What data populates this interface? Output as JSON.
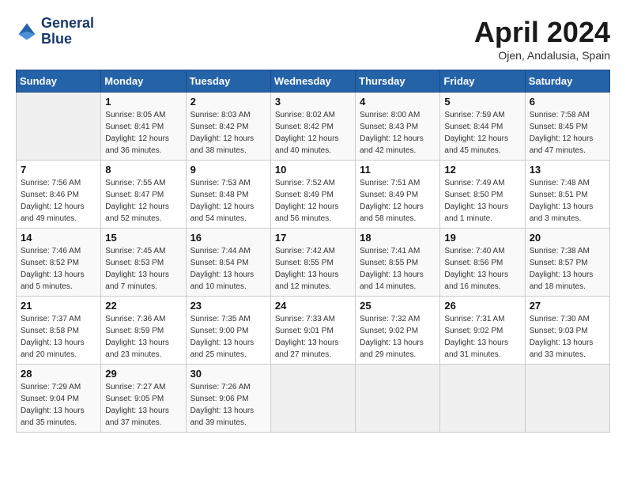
{
  "header": {
    "logo_line1": "General",
    "logo_line2": "Blue",
    "month_title": "April 2024",
    "location": "Ojen, Andalusia, Spain"
  },
  "calendar": {
    "days_of_week": [
      "Sunday",
      "Monday",
      "Tuesday",
      "Wednesday",
      "Thursday",
      "Friday",
      "Saturday"
    ],
    "weeks": [
      [
        {
          "day": "",
          "info": ""
        },
        {
          "day": "1",
          "info": "Sunrise: 8:05 AM\nSunset: 8:41 PM\nDaylight: 12 hours\nand 36 minutes."
        },
        {
          "day": "2",
          "info": "Sunrise: 8:03 AM\nSunset: 8:42 PM\nDaylight: 12 hours\nand 38 minutes."
        },
        {
          "day": "3",
          "info": "Sunrise: 8:02 AM\nSunset: 8:42 PM\nDaylight: 12 hours\nand 40 minutes."
        },
        {
          "day": "4",
          "info": "Sunrise: 8:00 AM\nSunset: 8:43 PM\nDaylight: 12 hours\nand 42 minutes."
        },
        {
          "day": "5",
          "info": "Sunrise: 7:59 AM\nSunset: 8:44 PM\nDaylight: 12 hours\nand 45 minutes."
        },
        {
          "day": "6",
          "info": "Sunrise: 7:58 AM\nSunset: 8:45 PM\nDaylight: 12 hours\nand 47 minutes."
        }
      ],
      [
        {
          "day": "7",
          "info": "Sunrise: 7:56 AM\nSunset: 8:46 PM\nDaylight: 12 hours\nand 49 minutes."
        },
        {
          "day": "8",
          "info": "Sunrise: 7:55 AM\nSunset: 8:47 PM\nDaylight: 12 hours\nand 52 minutes."
        },
        {
          "day": "9",
          "info": "Sunrise: 7:53 AM\nSunset: 8:48 PM\nDaylight: 12 hours\nand 54 minutes."
        },
        {
          "day": "10",
          "info": "Sunrise: 7:52 AM\nSunset: 8:49 PM\nDaylight: 12 hours\nand 56 minutes."
        },
        {
          "day": "11",
          "info": "Sunrise: 7:51 AM\nSunset: 8:49 PM\nDaylight: 12 hours\nand 58 minutes."
        },
        {
          "day": "12",
          "info": "Sunrise: 7:49 AM\nSunset: 8:50 PM\nDaylight: 13 hours\nand 1 minute."
        },
        {
          "day": "13",
          "info": "Sunrise: 7:48 AM\nSunset: 8:51 PM\nDaylight: 13 hours\nand 3 minutes."
        }
      ],
      [
        {
          "day": "14",
          "info": "Sunrise: 7:46 AM\nSunset: 8:52 PM\nDaylight: 13 hours\nand 5 minutes."
        },
        {
          "day": "15",
          "info": "Sunrise: 7:45 AM\nSunset: 8:53 PM\nDaylight: 13 hours\nand 7 minutes."
        },
        {
          "day": "16",
          "info": "Sunrise: 7:44 AM\nSunset: 8:54 PM\nDaylight: 13 hours\nand 10 minutes."
        },
        {
          "day": "17",
          "info": "Sunrise: 7:42 AM\nSunset: 8:55 PM\nDaylight: 13 hours\nand 12 minutes."
        },
        {
          "day": "18",
          "info": "Sunrise: 7:41 AM\nSunset: 8:55 PM\nDaylight: 13 hours\nand 14 minutes."
        },
        {
          "day": "19",
          "info": "Sunrise: 7:40 AM\nSunset: 8:56 PM\nDaylight: 13 hours\nand 16 minutes."
        },
        {
          "day": "20",
          "info": "Sunrise: 7:38 AM\nSunset: 8:57 PM\nDaylight: 13 hours\nand 18 minutes."
        }
      ],
      [
        {
          "day": "21",
          "info": "Sunrise: 7:37 AM\nSunset: 8:58 PM\nDaylight: 13 hours\nand 20 minutes."
        },
        {
          "day": "22",
          "info": "Sunrise: 7:36 AM\nSunset: 8:59 PM\nDaylight: 13 hours\nand 23 minutes."
        },
        {
          "day": "23",
          "info": "Sunrise: 7:35 AM\nSunset: 9:00 PM\nDaylight: 13 hours\nand 25 minutes."
        },
        {
          "day": "24",
          "info": "Sunrise: 7:33 AM\nSunset: 9:01 PM\nDaylight: 13 hours\nand 27 minutes."
        },
        {
          "day": "25",
          "info": "Sunrise: 7:32 AM\nSunset: 9:02 PM\nDaylight: 13 hours\nand 29 minutes."
        },
        {
          "day": "26",
          "info": "Sunrise: 7:31 AM\nSunset: 9:02 PM\nDaylight: 13 hours\nand 31 minutes."
        },
        {
          "day": "27",
          "info": "Sunrise: 7:30 AM\nSunset: 9:03 PM\nDaylight: 13 hours\nand 33 minutes."
        }
      ],
      [
        {
          "day": "28",
          "info": "Sunrise: 7:29 AM\nSunset: 9:04 PM\nDaylight: 13 hours\nand 35 minutes."
        },
        {
          "day": "29",
          "info": "Sunrise: 7:27 AM\nSunset: 9:05 PM\nDaylight: 13 hours\nand 37 minutes."
        },
        {
          "day": "30",
          "info": "Sunrise: 7:26 AM\nSunset: 9:06 PM\nDaylight: 13 hours\nand 39 minutes."
        },
        {
          "day": "",
          "info": ""
        },
        {
          "day": "",
          "info": ""
        },
        {
          "day": "",
          "info": ""
        },
        {
          "day": "",
          "info": ""
        }
      ]
    ]
  }
}
